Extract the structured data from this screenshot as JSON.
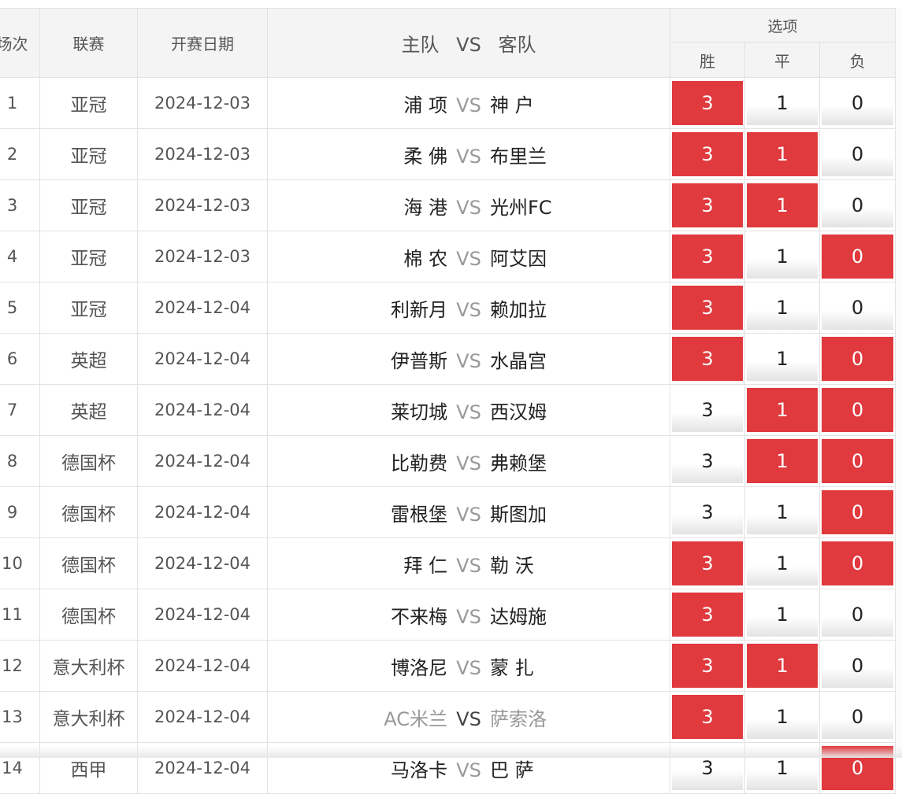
{
  "header": {
    "index": "场次",
    "league": "联赛",
    "date": "开赛日期",
    "home": "主队",
    "vs": "VS",
    "away": "客队",
    "options": "选项",
    "win": "胜",
    "draw": "平",
    "lose": "负"
  },
  "option_values": {
    "win": "3",
    "draw": "1",
    "lose": "0"
  },
  "colors": {
    "selected": "#e0393e",
    "header_bg": "#f4f4f4",
    "border": "#e2e2e2"
  },
  "matches": [
    {
      "index": "1",
      "league": "亚冠",
      "date": "2024-12-03",
      "home": "浦 项",
      "away": "神 户",
      "win": true,
      "draw": false,
      "lose": false,
      "muted": false
    },
    {
      "index": "2",
      "league": "亚冠",
      "date": "2024-12-03",
      "home": "柔 佛",
      "away": "布里兰",
      "win": true,
      "draw": true,
      "lose": false,
      "muted": false
    },
    {
      "index": "3",
      "league": "亚冠",
      "date": "2024-12-03",
      "home": "海 港",
      "away": "光州FC",
      "win": true,
      "draw": true,
      "lose": false,
      "muted": false
    },
    {
      "index": "4",
      "league": "亚冠",
      "date": "2024-12-03",
      "home": "棉 农",
      "away": "阿艾因",
      "win": true,
      "draw": false,
      "lose": true,
      "muted": false
    },
    {
      "index": "5",
      "league": "亚冠",
      "date": "2024-12-04",
      "home": "利新月",
      "away": "赖加拉",
      "win": true,
      "draw": false,
      "lose": false,
      "muted": false
    },
    {
      "index": "6",
      "league": "英超",
      "date": "2024-12-04",
      "home": "伊普斯",
      "away": "水晶宫",
      "win": true,
      "draw": false,
      "lose": true,
      "muted": false
    },
    {
      "index": "7",
      "league": "英超",
      "date": "2024-12-04",
      "home": "莱切城",
      "away": "西汉姆",
      "win": false,
      "draw": true,
      "lose": true,
      "muted": false
    },
    {
      "index": "8",
      "league": "德国杯",
      "date": "2024-12-04",
      "home": "比勒费",
      "away": "弗赖堡",
      "win": false,
      "draw": true,
      "lose": true,
      "muted": false
    },
    {
      "index": "9",
      "league": "德国杯",
      "date": "2024-12-04",
      "home": "雷根堡",
      "away": "斯图加",
      "win": false,
      "draw": false,
      "lose": true,
      "muted": false
    },
    {
      "index": "10",
      "league": "德国杯",
      "date": "2024-12-04",
      "home": "拜 仁",
      "away": "勒 沃",
      "win": true,
      "draw": false,
      "lose": true,
      "muted": false
    },
    {
      "index": "11",
      "league": "德国杯",
      "date": "2024-12-04",
      "home": "不来梅",
      "away": "达姆施",
      "win": true,
      "draw": false,
      "lose": false,
      "muted": false
    },
    {
      "index": "12",
      "league": "意大利杯",
      "date": "2024-12-04",
      "home": "博洛尼",
      "away": "蒙 扎",
      "win": true,
      "draw": true,
      "lose": false,
      "muted": false
    },
    {
      "index": "13",
      "league": "意大利杯",
      "date": "2024-12-04",
      "home": "AC米兰",
      "away": "萨索洛",
      "win": true,
      "draw": false,
      "lose": false,
      "muted": true
    },
    {
      "index": "14",
      "league": "西甲",
      "date": "2024-12-04",
      "home": "马洛卡",
      "away": "巴 萨",
      "win": false,
      "draw": false,
      "lose": true,
      "muted": false
    }
  ]
}
